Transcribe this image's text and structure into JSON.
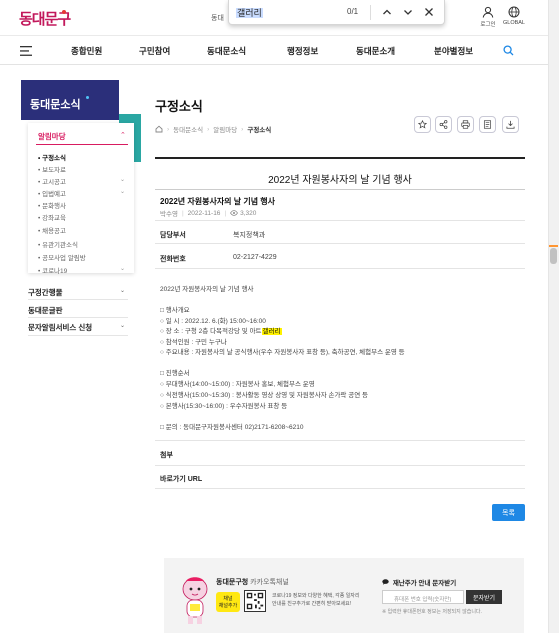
{
  "header": {
    "logo_text": "동대문구",
    "cut_text": "동대",
    "login_label": "로그인",
    "global_label": "GLOBAL"
  },
  "findbar": {
    "query": "갤러리",
    "count": "0/1"
  },
  "nav": {
    "items": [
      "종합민원",
      "구민참여",
      "동대문소식",
      "행정정보",
      "동대문소개",
      "분야별정보"
    ]
  },
  "sidebar": {
    "title": "동대문소식",
    "category": "알림마당",
    "sub_items": [
      {
        "label": "구정소식",
        "active": true,
        "chevron": false
      },
      {
        "label": "보도자료",
        "active": false,
        "chevron": false
      },
      {
        "label": "고시공고",
        "active": false,
        "chevron": true
      },
      {
        "label": "입법예고",
        "active": false,
        "chevron": true
      },
      {
        "label": "문화행사",
        "active": false,
        "chevron": false
      },
      {
        "label": "강좌교육",
        "active": false,
        "chevron": false
      },
      {
        "label": "채용공고",
        "active": false,
        "chevron": false
      },
      {
        "label": "유관기관소식",
        "active": false,
        "chevron": false
      },
      {
        "label": "공모사업 알림방",
        "active": false,
        "chevron": false
      },
      {
        "label": "코로나19",
        "active": false,
        "chevron": true
      }
    ],
    "menus": [
      {
        "label": "구정간행물",
        "chevron": true
      },
      {
        "label": "동대문글판",
        "chevron": false
      },
      {
        "label": "문자알림서비스 신청",
        "chevron": true
      }
    ]
  },
  "content": {
    "page_title": "구정소식",
    "breadcrumb": [
      "동대문소식",
      "알림마당",
      "구정소식"
    ],
    "post_title": "2022년 자원봉사자의 날 기념 행사",
    "sub_title": "2022년 자원봉사자의 날 기념 행사",
    "author": "박수영",
    "date": "2022-11-16",
    "views": "3,320",
    "dept_label": "담당부서",
    "dept_value": "복지정책과",
    "phone_label": "전화번호",
    "phone_value": "02-2127-4229",
    "body": {
      "intro": "2022년 자원봉사자의 날 기념 행사",
      "s1_title": "□ 행사개요",
      "s1_l1": "○ 일     시 : 2022.12. 6.(화) 15:00~16:00",
      "s1_l2_pre": "○ 장     소 : 구청 2층 다목적강당 및 아트",
      "s1_l2_mark": "갤러리",
      "s1_l3": "○ 참석인원 : 구민 누구나",
      "s1_l4": "○ 주요내용 : 자원봉사의 날 공식행사(우수 자원봉사자 표창 등), 축하공연, 체험부스 운영 등",
      "s2_title": "□ 진행순서",
      "s2_l1": "○ 부대행사(14:00~15:00) : 자원봉사 홍보, 체험부스 운영",
      "s2_l2": "○ 식전행사(15:00~15:30) : 봉사활동 영상 상영 및 자원봉사자 손가락 공연 등",
      "s2_l3": "○ 본행사(15:30~16:00) : 우수자원봉사 표창 등",
      "contact": "□ 문의 : 동대문구자원봉사센터 02)2171-6208~6210"
    },
    "attach_label": "첨부",
    "shortcut_label": "바로가기 URL",
    "list_button": "목록"
  },
  "footer": {
    "kakao_title_bold": "동대문구청",
    "kakao_title_rest": " 카카오톡채널",
    "kakao_btn_top": "채널",
    "kakao_btn_bottom": "채널추가",
    "kakao_desc1": "코로나19 정보와 다양한 혜택, 각종 일자리",
    "kakao_desc2": "안내를 친구추가로 간편히 받아보세요!",
    "sms_title": "재난주가 안내 문자받기",
    "sms_placeholder": "휴대폰 번호 입력(숫자만)",
    "sms_button": "문자받기",
    "sms_note": "※ 입력한 휴대폰번호 정보는 저장되지 않습니다."
  }
}
